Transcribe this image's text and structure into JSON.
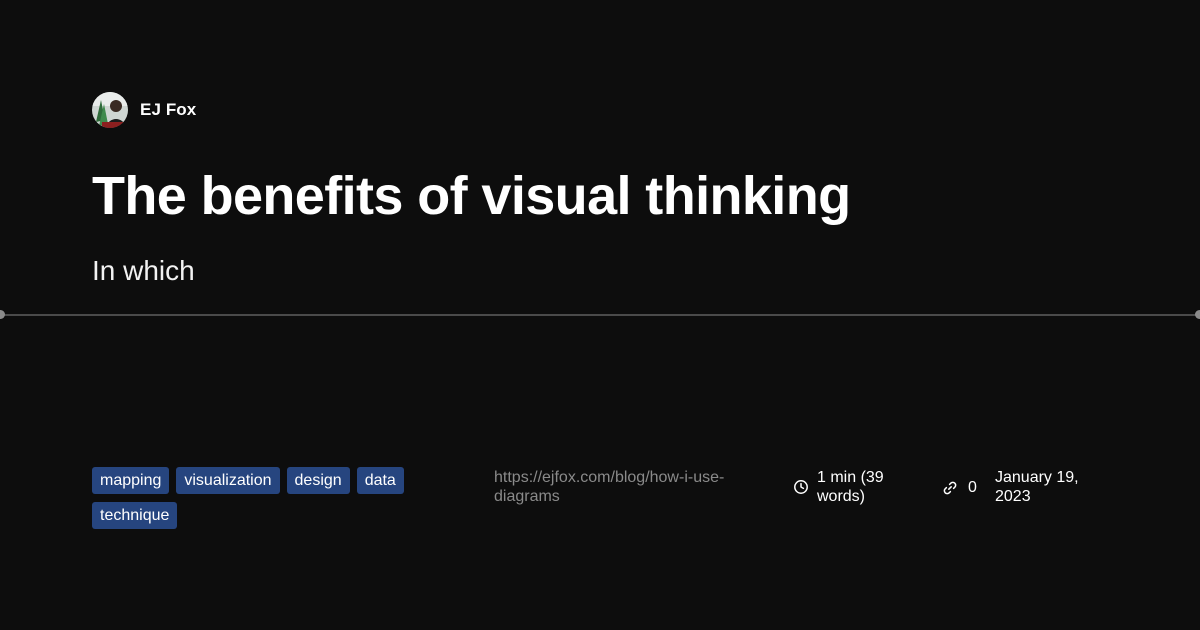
{
  "author": {
    "name": "EJ Fox",
    "avatar_icon": "author-avatar-image"
  },
  "post": {
    "title": "The benefits of visual thinking",
    "subtitle": "In which"
  },
  "tags": [
    "mapping",
    "visualization",
    "design",
    "data",
    "technique"
  ],
  "meta": {
    "url": "https://ejfox.com/blog/how-i-use-diagrams",
    "reading_time": "1 min (39 words)",
    "reading_time_icon": "clock-icon",
    "link_count": "0",
    "link_icon": "link-icon",
    "date": "January 19, 2023"
  },
  "colors": {
    "background": "#0d0d0d",
    "tag_background": "#26457f",
    "muted_text": "#8a8a8a",
    "divider": "#4a4a4a"
  }
}
